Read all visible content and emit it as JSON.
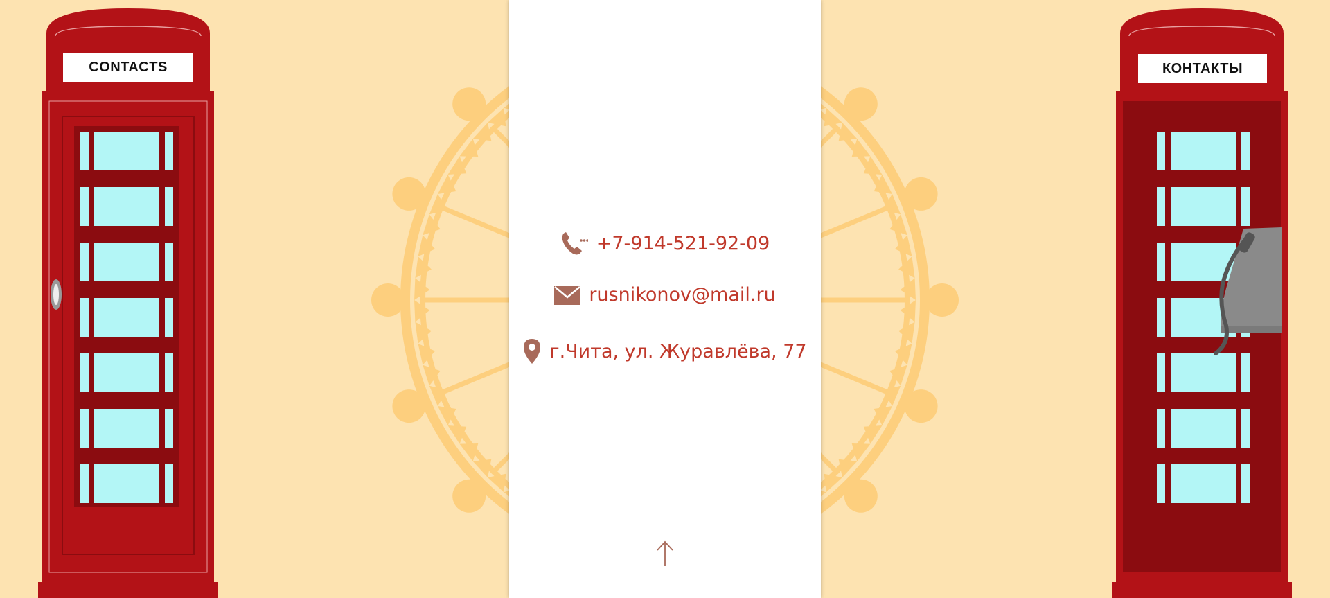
{
  "signs": {
    "left": "CONTACTS",
    "right": "КОНТАКТЫ"
  },
  "contacts": {
    "phone": "+7-914-521-92-09",
    "email": "rusnikonov@mail.ru",
    "address": "г.Чита, ул. Журавлёва, 77"
  },
  "icons": {
    "phone": "phone-icon",
    "email": "envelope-icon",
    "address": "map-pin-icon",
    "scroll_top": "arrow-up-icon"
  },
  "colors": {
    "background": "#fde3b1",
    "wheel": "#fdcf7e",
    "booth_red": "#b31217",
    "booth_dark": "#8b0c10",
    "glass": "#b3f6f6",
    "text": "#c0392b",
    "icon": "#a86a5a"
  }
}
